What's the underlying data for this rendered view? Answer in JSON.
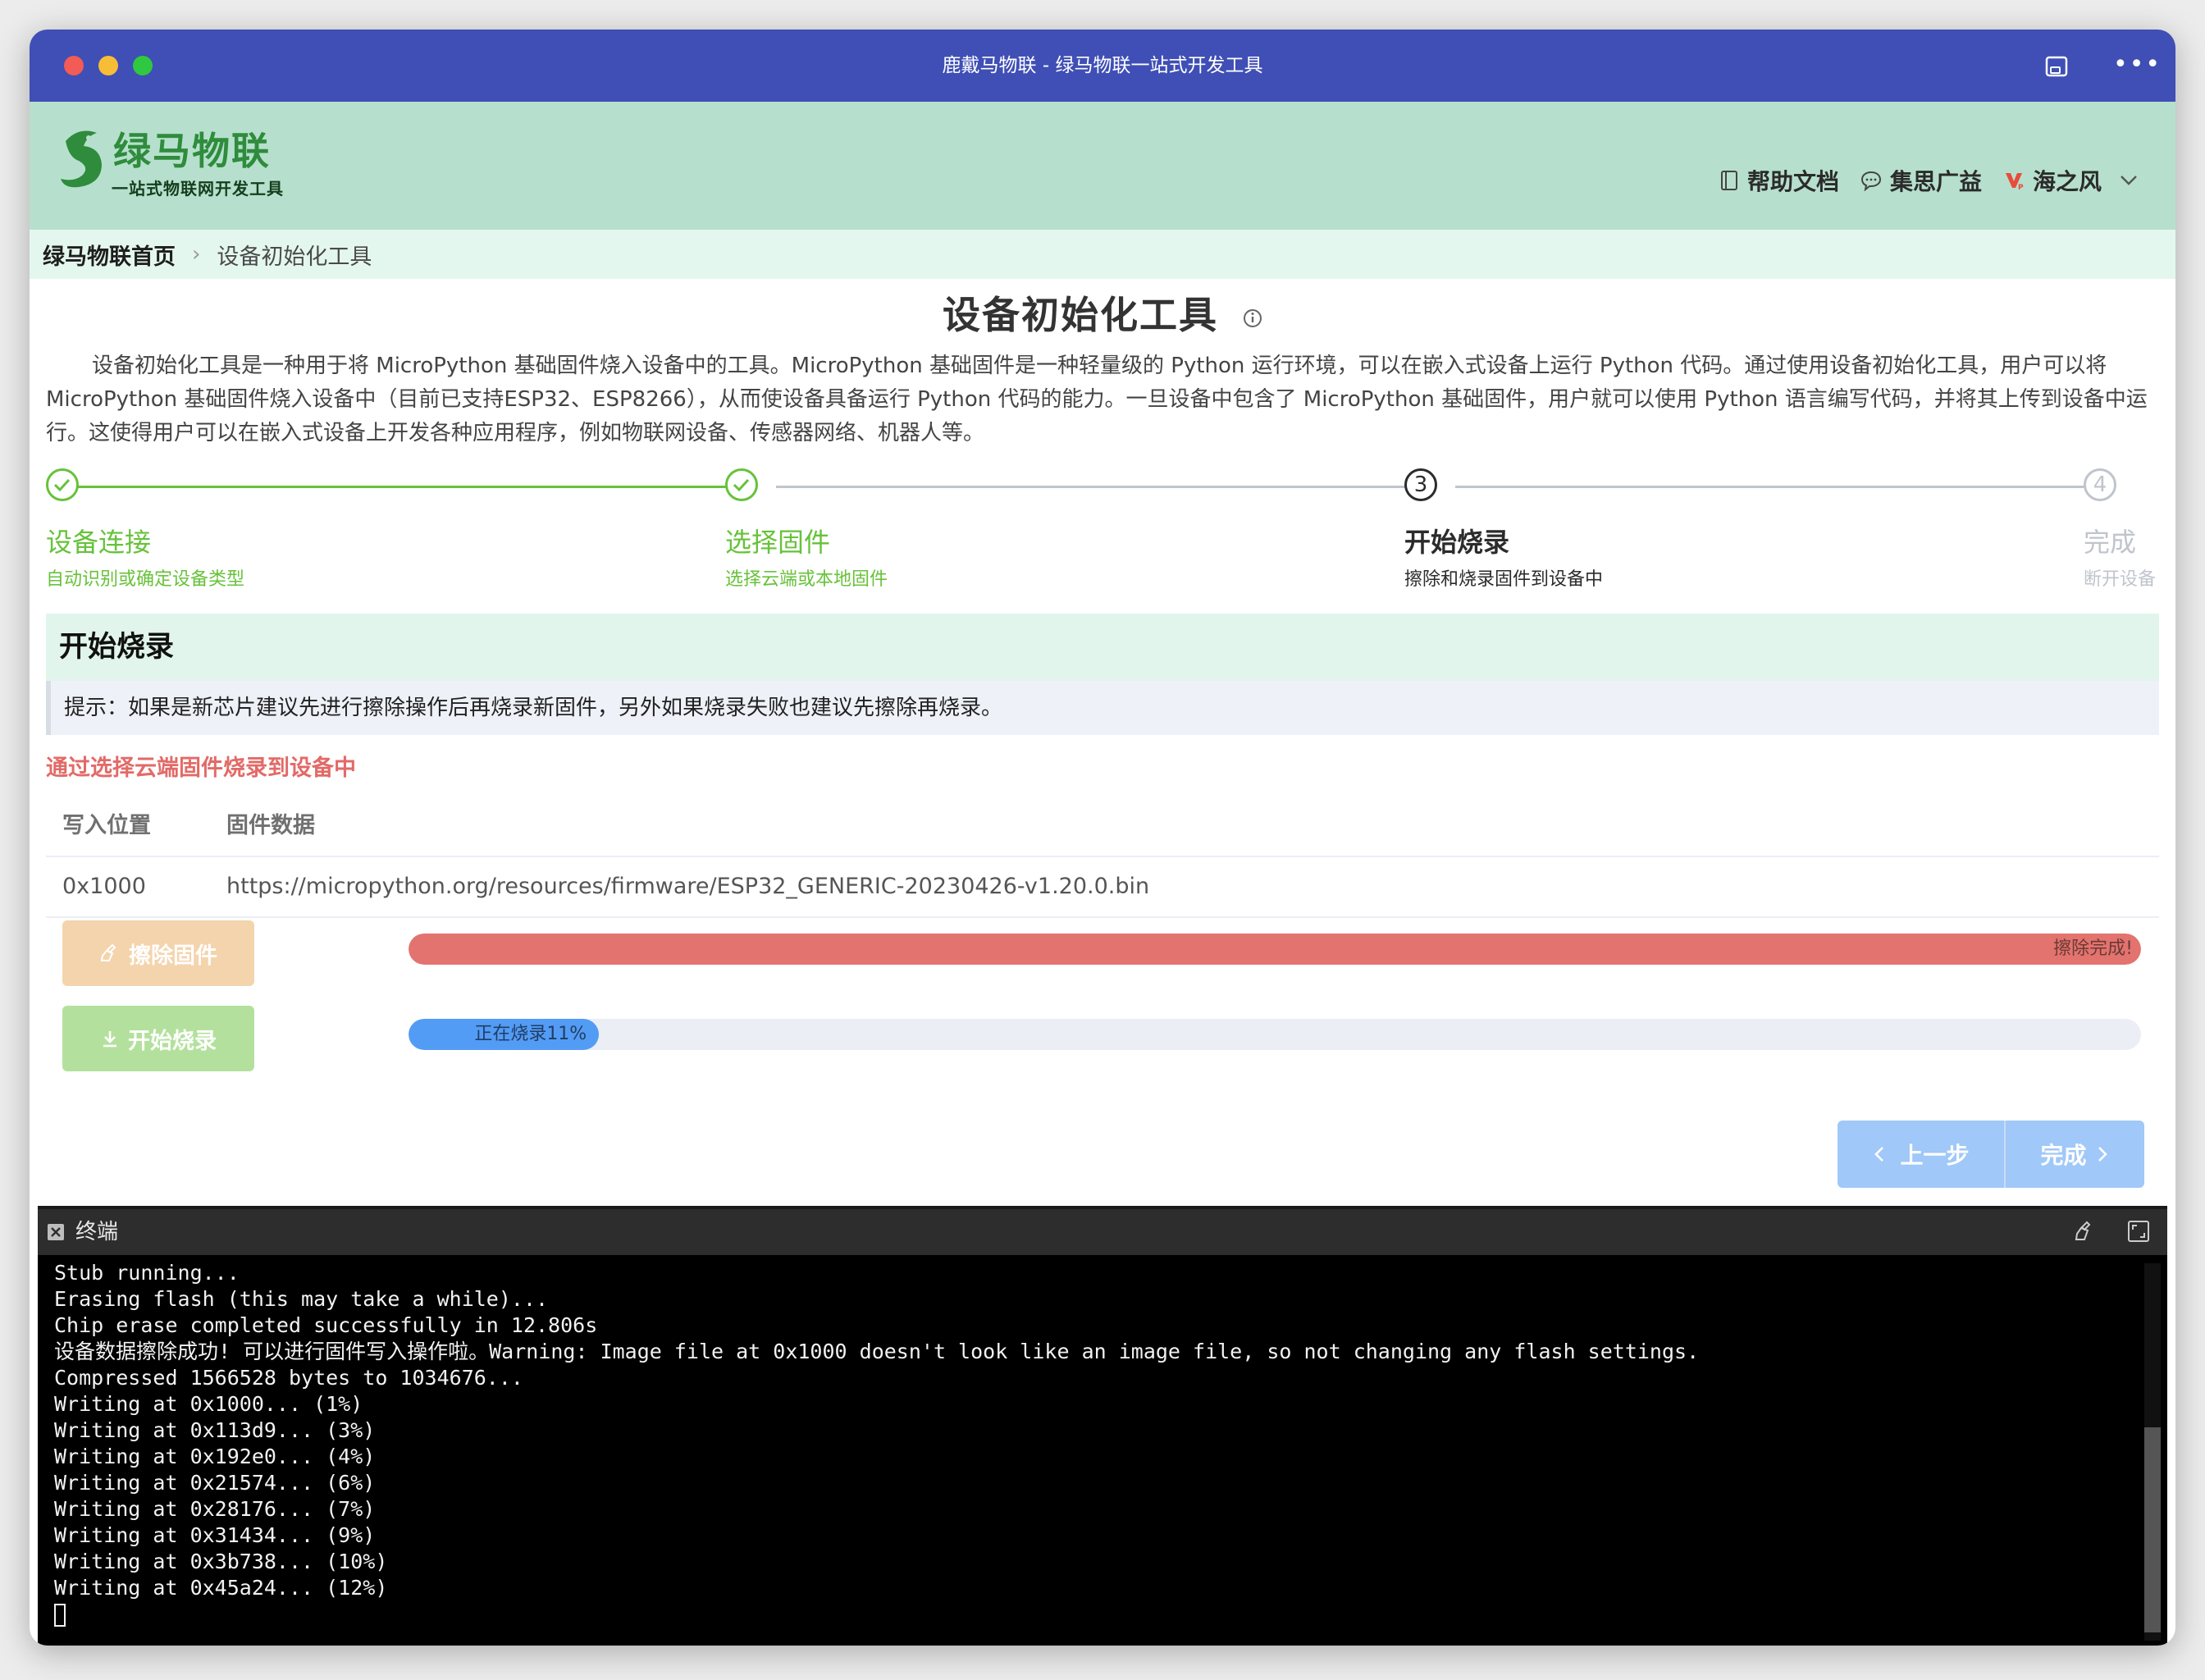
{
  "window": {
    "title": "鹿戴马物联 - 绿马物联一站式开发工具"
  },
  "header": {
    "logo_main": "绿马物联",
    "logo_sub": "一站式物联网开发工具",
    "nav": [
      {
        "label": "帮助文档",
        "icon": "book-icon"
      },
      {
        "label": "集思广益",
        "icon": "chat-bubble-icon"
      },
      {
        "label": "海之风",
        "icon": "user-logo-icon"
      }
    ]
  },
  "breadcrumb": {
    "home": "绿马物联首页",
    "current": "设备初始化工具"
  },
  "page": {
    "title": "设备初始化工具",
    "description": "设备初始化工具是一种用于将 MicroPython 基础固件烧入设备中的工具。MicroPython 基础固件是一种轻量级的 Python 运行环境，可以在嵌入式设备上运行 Python 代码。通过使用设备初始化工具，用户可以将 MicroPython 基础固件烧入设备中（目前已支持ESP32、ESP8266），从而使设备具备运行 Python 代码的能力。一旦设备中包含了 MicroPython 基础固件，用户就可以使用 Python 语言编写代码，并将其上传到设备中运行。这使得用户可以在嵌入式设备上开发各种应用程序，例如物联网设备、传感器网络、机器人等。"
  },
  "steps": [
    {
      "number": "1",
      "title": "设备连接",
      "desc": "自动识别或确定设备类型",
      "status": "done"
    },
    {
      "number": "2",
      "title": "选择固件",
      "desc": "选择云端或本地固件",
      "status": "done"
    },
    {
      "number": "3",
      "title": "开始烧录",
      "desc": "擦除和烧录固件到设备中",
      "status": "active"
    },
    {
      "number": "4",
      "title": "完成",
      "desc": "断开设备",
      "status": "wait"
    }
  ],
  "burn": {
    "section_title": "开始烧录",
    "tip": "提示：如果是新芯片建议先进行擦除操作后再烧录新固件，另外如果烧录失败也建议先擦除再烧录。",
    "cloud_note": "通过选择云端固件烧录到设备中",
    "table": {
      "headers": [
        "写入位置",
        "固件数据"
      ],
      "rows": [
        [
          "0x1000",
          "https://micropython.org/resources/firmware/ESP32_GENERIC-20230426-v1.20.0.bin"
        ]
      ]
    },
    "erase_button": "擦除固件",
    "burn_button": "开始烧录",
    "erase_progress": {
      "percent": 100,
      "text": "擦除完成!"
    },
    "burn_progress": {
      "percent": 11,
      "text": "正在烧录11%"
    },
    "prev_button": "上一步",
    "finish_button": "完成"
  },
  "terminal": {
    "title": "终端",
    "lines": [
      "Stub running...",
      "Erasing flash (this may take a while)...",
      "Chip erase completed successfully in 12.806s",
      "设备数据擦除成功! 可以进行固件写入操作啦。Warning: Image file at 0x1000 doesn't look like an image file, so not changing any flash settings.",
      "Compressed 1566528 bytes to 1034676...",
      "Writing at 0x1000... (1%)",
      "Writing at 0x113d9... (3%)",
      "Writing at 0x192e0... (4%)",
      "Writing at 0x21574... (6%)",
      "Writing at 0x28176... (7%)",
      "Writing at 0x31434... (9%)",
      "Writing at 0x3b738... (10%)",
      "Writing at 0x45a24... (12%)"
    ]
  },
  "colors": {
    "titlebar": "#3f4fb5",
    "header": "#b6e0cd",
    "step_done": "#67c23a",
    "erase_bar": "#e3736f",
    "burn_bar": "#539cf5"
  }
}
